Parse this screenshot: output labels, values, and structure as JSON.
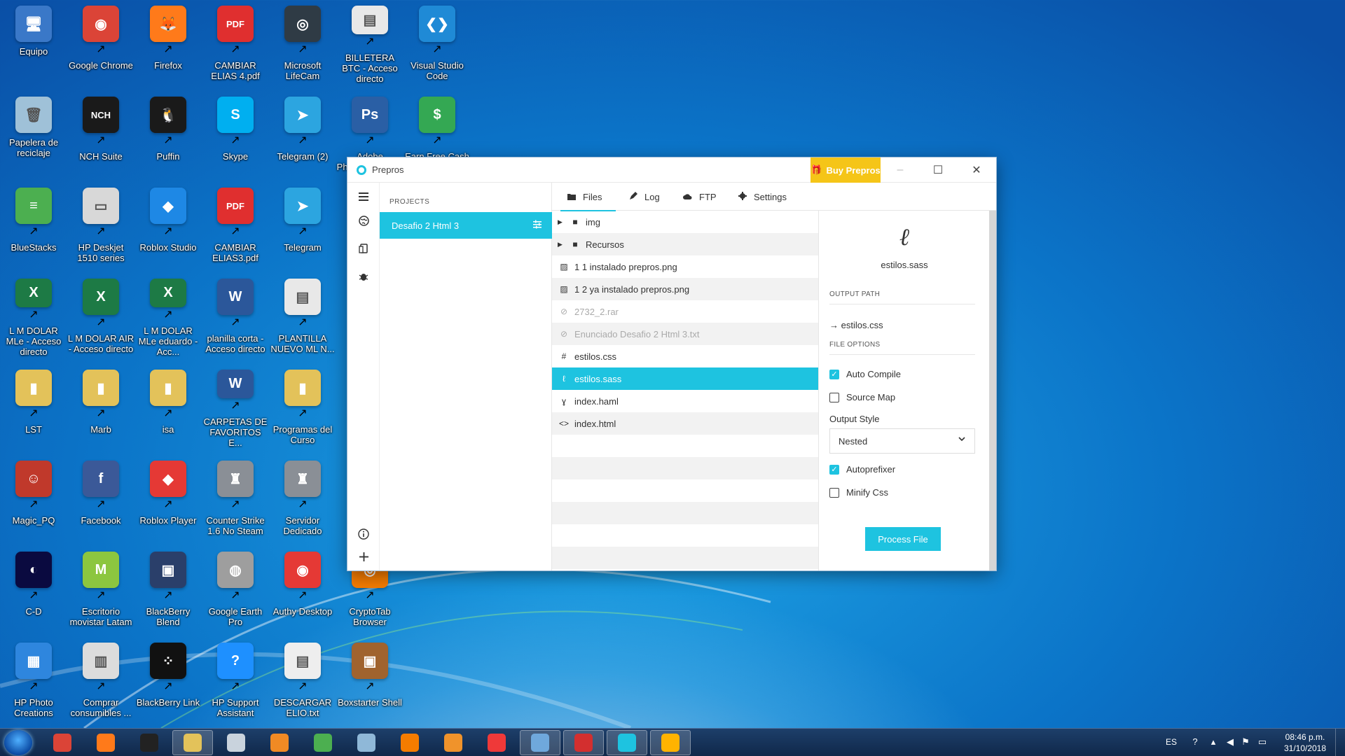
{
  "desktop": {
    "icons": [
      {
        "label": "Equipo",
        "glyph": "🖥",
        "color": "#3a78c8"
      },
      {
        "label": "Google Chrome",
        "glyph": "◉",
        "color": "#db4437"
      },
      {
        "label": "Firefox",
        "glyph": "🦊",
        "color": "#ff7a1a"
      },
      {
        "label": "CAMBIAR ELIAS 4.pdf",
        "glyph": "PDF",
        "color": "#e02f2f"
      },
      {
        "label": "Microsoft LifeCam",
        "glyph": "◎",
        "color": "#2f3b45"
      },
      {
        "label": "BILLETERA BTC - Acceso directo",
        "glyph": "▤",
        "color": "#e8e8e8"
      },
      {
        "label": "Visual Studio Code",
        "glyph": "❮❯",
        "color": "#1f8ad6"
      },
      {
        "label": "Papelera de reciclaje",
        "glyph": "🗑",
        "color": "#9fc1d8"
      },
      {
        "label": "NCH Suite",
        "glyph": "NCH",
        "color": "#1a1a1a"
      },
      {
        "label": "Puffin",
        "glyph": "🐧",
        "color": "#1a1a1a"
      },
      {
        "label": "Skype",
        "glyph": "S",
        "color": "#00aff0"
      },
      {
        "label": "Telegram (2)",
        "glyph": "➤",
        "color": "#2ca5e0"
      },
      {
        "label": "Adobe Photoshop CS...",
        "glyph": "Ps",
        "color": "#2a5fa5"
      },
      {
        "label": "Earn Free Cash",
        "glyph": "$",
        "color": "#34a853"
      },
      {
        "label": "BlueStacks",
        "glyph": "≡",
        "color": "#4caf50"
      },
      {
        "label": "HP Deskjet 1510 series",
        "glyph": "▭",
        "color": "#d8d8d8"
      },
      {
        "label": "Roblox Studio",
        "glyph": "◆",
        "color": "#1e88e5"
      },
      {
        "label": "CAMBIAR ELIAS3.pdf",
        "glyph": "PDF",
        "color": "#e02f2f"
      },
      {
        "label": "Telegram",
        "glyph": "➤",
        "color": "#2ca5e0"
      },
      {
        "label": "L M DOLAR MLe - Acceso directo",
        "glyph": "X",
        "color": "#1d7a45"
      },
      {
        "label": "L M DOLAR AIR - Acceso directo",
        "glyph": "X",
        "color": "#1d7a45"
      },
      {
        "label": "L M DOLAR MLe eduardo - Acc...",
        "glyph": "X",
        "color": "#1d7a45"
      },
      {
        "label": "planilla corta - Acceso directo",
        "glyph": "W",
        "color": "#2b579a"
      },
      {
        "label": "PLANTILLA NUEVO ML N...",
        "glyph": "▤",
        "color": "#e8e8e8"
      },
      {
        "label": "LST",
        "glyph": "▮",
        "color": "#e3c25a"
      },
      {
        "label": "Marb",
        "glyph": "▮",
        "color": "#e3c25a"
      },
      {
        "label": "isa",
        "glyph": "▮",
        "color": "#e3c25a"
      },
      {
        "label": "CARPETAS DE FAVORITOS E...",
        "glyph": "W",
        "color": "#2b579a"
      },
      {
        "label": "Programas del Curso",
        "glyph": "▮",
        "color": "#e3c25a"
      },
      {
        "label": "Magic_PQ",
        "glyph": "☺",
        "color": "#c0392b"
      },
      {
        "label": "Facebook",
        "glyph": "f",
        "color": "#3b5998"
      },
      {
        "label": "Roblox Player",
        "glyph": "◆",
        "color": "#e53935"
      },
      {
        "label": "Counter Strike 1.6 No Steam",
        "glyph": "♜",
        "color": "#8a8f96"
      },
      {
        "label": "Servidor Dedicado",
        "glyph": "♜",
        "color": "#8a8f96"
      },
      {
        "label": "C-D",
        "glyph": "◐",
        "color": "#0a0a40"
      },
      {
        "label": "Escritorio movistar Latam",
        "glyph": "M",
        "color": "#8cc63f"
      },
      {
        "label": "BlackBerry Blend",
        "glyph": "▣",
        "color": "#2a3f6a"
      },
      {
        "label": "Google Earth Pro",
        "glyph": "◍",
        "color": "#9e9e9e"
      },
      {
        "label": "Authy Desktop",
        "glyph": "◉",
        "color": "#e53935"
      },
      {
        "label": "CryptoTab Browser",
        "glyph": "◎",
        "color": "#f57c00"
      },
      {
        "label": "HP Photo Creations",
        "glyph": "▦",
        "color": "#2e86de"
      },
      {
        "label": "Comprar consumibles ...",
        "glyph": "▥",
        "color": "#dcdcdc"
      },
      {
        "label": "BlackBerry Link",
        "glyph": "⁘",
        "color": "#111111"
      },
      {
        "label": "HP Support Assistant",
        "glyph": "?",
        "color": "#1e90ff"
      },
      {
        "label": "DESCARGAR ELIO.txt",
        "glyph": "▤",
        "color": "#eeeeee"
      },
      {
        "label": "Boxstarter Shell",
        "glyph": "▣",
        "color": "#a0632e"
      }
    ]
  },
  "prepros": {
    "title": "Prepros",
    "buy_label": "Buy Prepros",
    "projects_header": "PROJECTS",
    "project_name": "Desafio 2 Html 3",
    "tabs": [
      {
        "label": "Files",
        "icon": "folder-icon"
      },
      {
        "label": "Log",
        "icon": "pencil-icon"
      },
      {
        "label": "FTP",
        "icon": "cloud-icon"
      },
      {
        "label": "Settings",
        "icon": "gear-icon"
      }
    ],
    "files": [
      {
        "name": "img",
        "type": "folder",
        "icon": "■",
        "dim": false,
        "selected": false
      },
      {
        "name": "Recursos",
        "type": "folder",
        "icon": "■",
        "dim": false,
        "selected": false
      },
      {
        "name": "1 1 instalado prepros.png",
        "type": "image",
        "icon": "▨",
        "dim": false,
        "selected": false
      },
      {
        "name": "1 2 ya instalado prepros.png",
        "type": "image",
        "icon": "▨",
        "dim": false,
        "selected": false
      },
      {
        "name": "2732_2.rar",
        "type": "ignored",
        "icon": "⊘",
        "dim": true,
        "selected": false
      },
      {
        "name": "Enunciado Desafio 2 Html 3.txt",
        "type": "ignored",
        "icon": "⊘",
        "dim": true,
        "selected": false
      },
      {
        "name": "estilos.css",
        "type": "css",
        "icon": "#",
        "dim": false,
        "selected": false
      },
      {
        "name": "estilos.sass",
        "type": "sass",
        "icon": "ℓ",
        "dim": false,
        "selected": true
      },
      {
        "name": "index.haml",
        "type": "haml",
        "icon": "ɣ",
        "dim": false,
        "selected": false
      },
      {
        "name": "index.html",
        "type": "html",
        "icon": "<>",
        "dim": false,
        "selected": false
      },
      {
        "name": "",
        "type": "empty",
        "icon": "",
        "dim": false,
        "selected": false
      },
      {
        "name": "",
        "type": "empty",
        "icon": "",
        "dim": false,
        "selected": false
      },
      {
        "name": "",
        "type": "empty",
        "icon": "",
        "dim": false,
        "selected": false
      },
      {
        "name": "",
        "type": "empty",
        "icon": "",
        "dim": false,
        "selected": false
      },
      {
        "name": "",
        "type": "empty",
        "icon": "",
        "dim": false,
        "selected": false
      },
      {
        "name": "",
        "type": "empty",
        "icon": "",
        "dim": false,
        "selected": false
      }
    ],
    "details": {
      "filename": "estilos.sass",
      "output_path_header": "OUTPUT PATH",
      "output_path": "→ estilos.css",
      "file_options_header": "FILE OPTIONS",
      "auto_compile": {
        "label": "Auto Compile",
        "checked": true
      },
      "source_map": {
        "label": "Source Map",
        "checked": false
      },
      "output_style_label": "Output Style",
      "output_style_value": "Nested",
      "autoprefixer": {
        "label": "Autoprefixer",
        "checked": true
      },
      "minify_css": {
        "label": "Minify Css",
        "checked": false
      },
      "process_label": "Process File"
    },
    "accent_color": "#1ec3e0",
    "buy_color": "#f5c518"
  },
  "taskbar": {
    "items": [
      {
        "name": "chrome",
        "color": "#db4437",
        "open": false
      },
      {
        "name": "firefox",
        "color": "#ff7a1a",
        "open": false
      },
      {
        "name": "puffin",
        "color": "#222222",
        "open": false
      },
      {
        "name": "explorer",
        "color": "#e3c25a",
        "open": true
      },
      {
        "name": "calculator",
        "color": "#c9d3dd",
        "open": false
      },
      {
        "name": "media-player",
        "color": "#f08a24",
        "open": false
      },
      {
        "name": "bluestacks",
        "color": "#4caf50",
        "open": false
      },
      {
        "name": "notepad",
        "color": "#8fb8d8",
        "open": false
      },
      {
        "name": "ccleaner",
        "color": "#f57c00",
        "open": false
      },
      {
        "name": "sublime",
        "color": "#f0932b",
        "open": false
      },
      {
        "name": "vivaldi",
        "color": "#ef3939",
        "open": false
      },
      {
        "name": "photos",
        "color": "#6fa8dc",
        "open": true
      },
      {
        "name": "acrobat",
        "color": "#d32f2f",
        "open": true
      },
      {
        "name": "prepros",
        "color": "#1ec3e0",
        "open": true
      },
      {
        "name": "paint",
        "color": "#ffb300",
        "open": true
      }
    ],
    "language": "ES",
    "time": "08:46 p.m.",
    "date": "31/10/2018"
  }
}
